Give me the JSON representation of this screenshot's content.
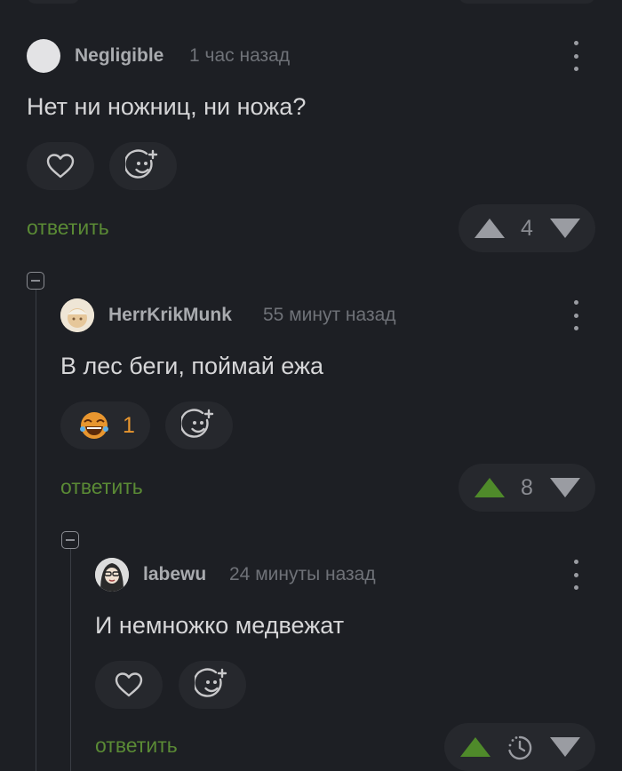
{
  "comments": [
    {
      "author": "Negligible",
      "time": "1 час назад",
      "text": "Нет ни ножниц, ни ножа?",
      "reply": "ответить",
      "votes": "4"
    },
    {
      "author": "HerrKrikMunk",
      "time": "55 минут назад",
      "text": "В лес беги, поймай ежа",
      "reaction_count": "1",
      "reply": "ответить",
      "votes": "8"
    },
    {
      "author": "labewu",
      "time": "24 минуты назад",
      "text": "И немножко медвежат",
      "reply": "ответить",
      "votes_icon": "clock-loading-icon"
    }
  ],
  "colors": {
    "background": "#1d1f24",
    "pill": "#26282d",
    "reply_green": "#5a8a35",
    "upvote_active": "#4f8a2a",
    "vote_inactive": "#9a9ca2"
  },
  "icons": [
    "heart-icon",
    "add-emoji-icon",
    "kebab-menu-icon",
    "upvote-icon",
    "downvote-icon",
    "collapse-icon",
    "laughing-emoji-icon"
  ]
}
